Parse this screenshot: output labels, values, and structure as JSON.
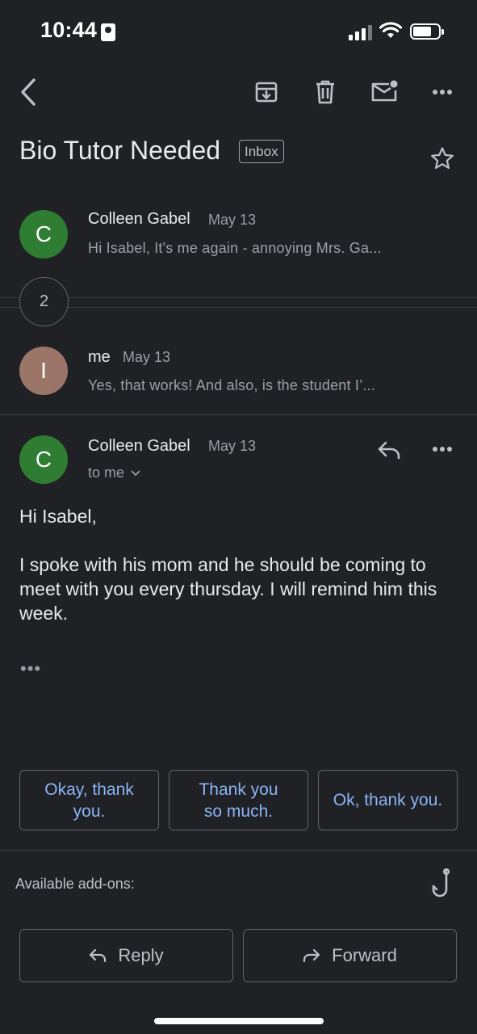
{
  "status_bar": {
    "time": "10:44"
  },
  "toolbar": {
    "back_icon": "chevron-left-icon",
    "archive_icon": "archive-icon",
    "delete_icon": "trash-icon",
    "mark_unread_icon": "mail-unread-icon",
    "more_icon": "more-horizontal-icon"
  },
  "subject": "Bio Tutor Needed",
  "label_badge": "Inbox",
  "thread": {
    "message1": {
      "avatar_letter": "C",
      "avatar_color": "#2e7d32",
      "sender": "Colleen Gabel",
      "date": "May 13",
      "snippet": "Hi Isabel, It's me again - annoying Mrs. Ga..."
    },
    "collapsed_count": "2",
    "message2": {
      "avatar_letter": "I",
      "avatar_color": "#9a7568",
      "sender": "me",
      "date": "May 13",
      "snippet": "Yes, that works! And also, is the student I’..."
    },
    "message3": {
      "avatar_letter": "C",
      "avatar_color": "#2e7d32",
      "sender": "Colleen Gabel",
      "date": "May 13",
      "recipient": "to me",
      "greeting": "Hi Isabel,",
      "body": "I spoke with his mom and he should be coming to meet with you every thursday. I will remind him this week.",
      "trimmed_content": "•••"
    }
  },
  "smart_replies": [
    "Okay, thank you.",
    "Thank you so much.",
    "Ok, thank you."
  ],
  "addons": {
    "label": "Available add-ons:"
  },
  "actions": {
    "reply": "Reply",
    "forward": "Forward"
  }
}
